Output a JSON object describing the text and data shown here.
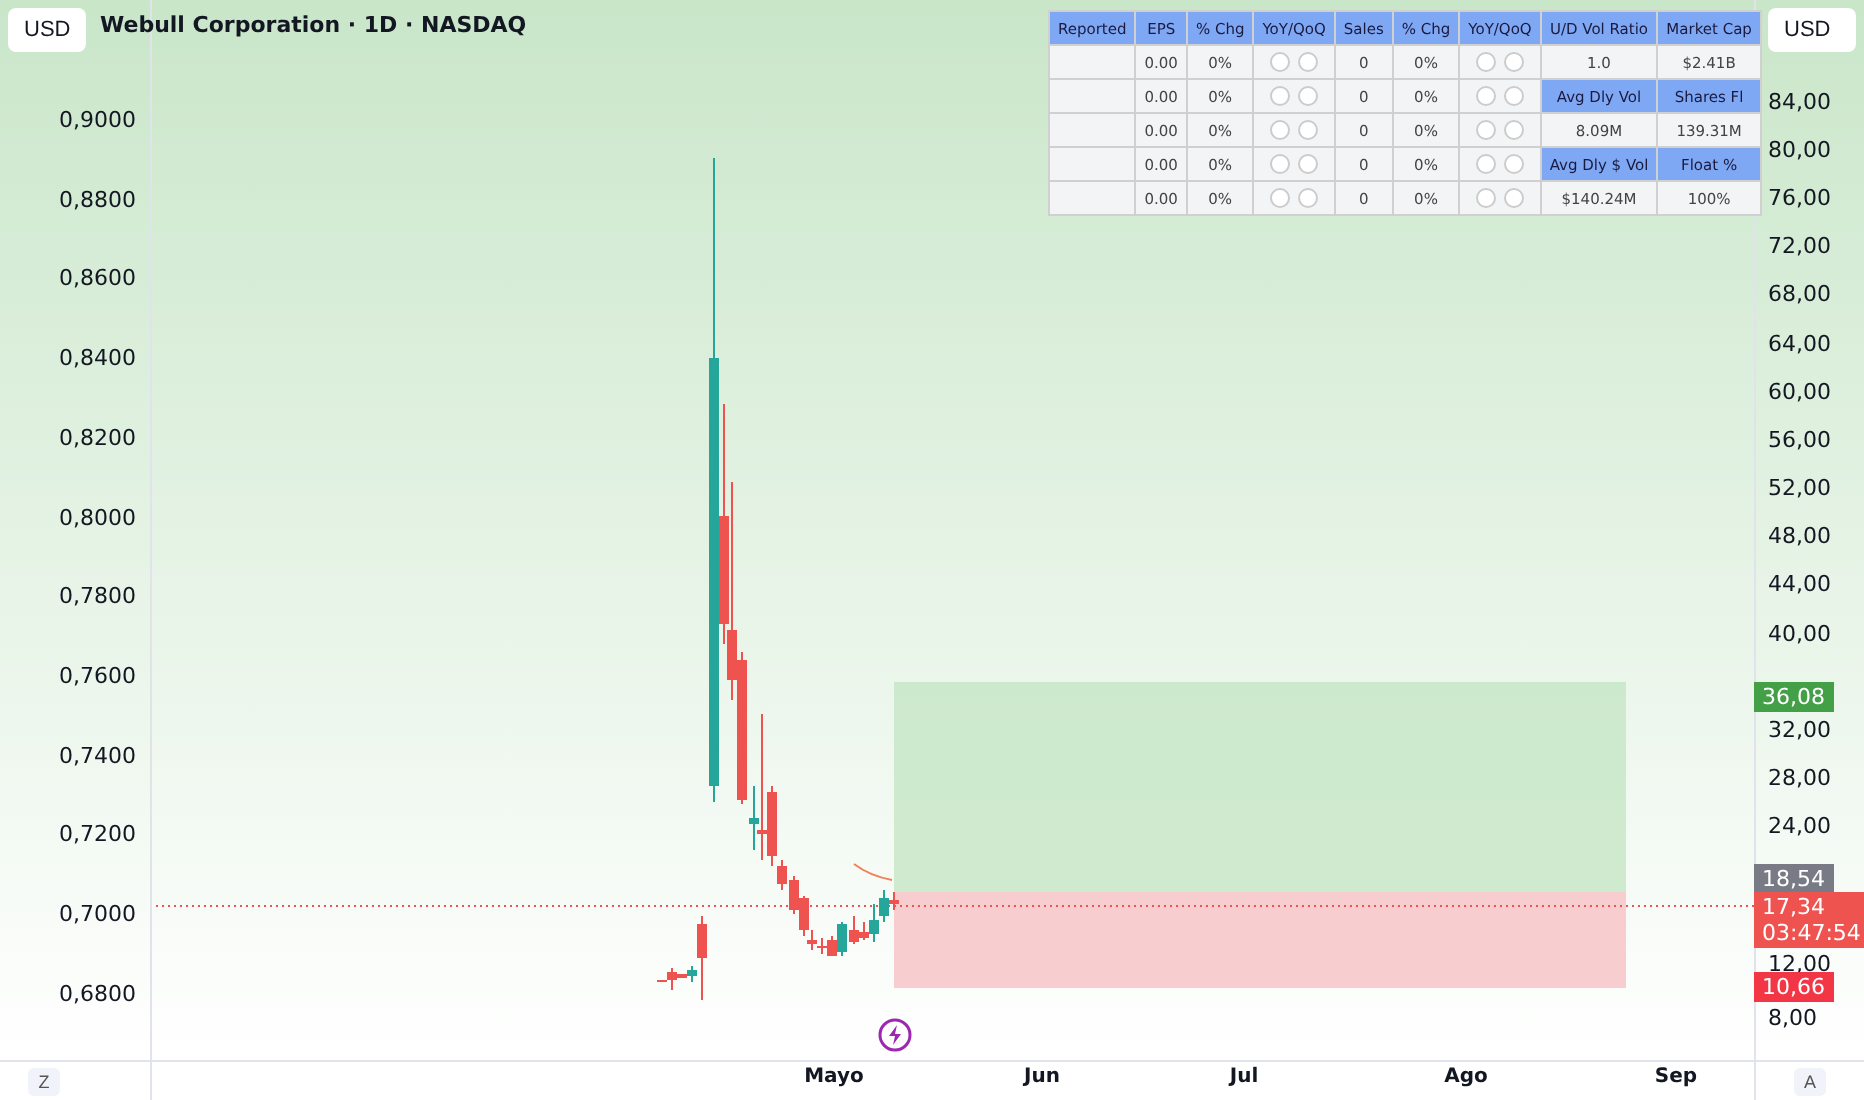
{
  "title": "Webull Corporation · 1D · NASDAQ",
  "currency_left": "USD",
  "currency_right": "USD",
  "left_axis": [
    "0,9000",
    "0,8800",
    "0,8600",
    "0,8400",
    "0,8200",
    "0,8000",
    "0,7800",
    "0,7600",
    "0,7400",
    "0,7200",
    "0,7000",
    "0,6800"
  ],
  "right_axis": [
    "84,00",
    "80,00",
    "76,00",
    "72,00",
    "68,00",
    "64,00",
    "60,00",
    "56,00",
    "52,00",
    "48,00",
    "44,00",
    "40,00",
    "32,00",
    "28,00",
    "24,00",
    "12,00",
    "8,00"
  ],
  "price_labels": [
    {
      "kind": "target",
      "text": "36,08",
      "color": "#43a047"
    },
    {
      "kind": "entry",
      "text": "18,54",
      "color": "#787b86"
    },
    {
      "kind": "last",
      "text": "17,34",
      "countdown": "03:47:54",
      "color": "#ef5350"
    },
    {
      "kind": "stop",
      "text": "10,66",
      "color": "#f23645"
    }
  ],
  "table": {
    "columns": [
      "Reported",
      "EPS",
      "% Chg",
      "YoY/QoQ",
      "Sales",
      "% Chg",
      "YoY/QoQ",
      "U/D Vol Ratio",
      "Market Cap"
    ],
    "rows": [
      {
        "eps": "0.00",
        "eps_chg": "0%",
        "sales": "0",
        "sales_chg": "0%",
        "side": [
          {
            "kind": "value",
            "text": "1.0"
          },
          {
            "kind": "value",
            "text": "$2.41B"
          }
        ]
      },
      {
        "eps": "0.00",
        "eps_chg": "0%",
        "sales": "0",
        "sales_chg": "0%",
        "side": [
          {
            "kind": "header",
            "text": "Avg Dly Vol"
          },
          {
            "kind": "header",
            "text": "Shares Fl"
          }
        ]
      },
      {
        "eps": "0.00",
        "eps_chg": "0%",
        "sales": "0",
        "sales_chg": "0%",
        "side": [
          {
            "kind": "value",
            "text": "8.09M"
          },
          {
            "kind": "value",
            "text": "139.31M"
          }
        ]
      },
      {
        "eps": "0.00",
        "eps_chg": "0%",
        "sales": "0",
        "sales_chg": "0%",
        "side": [
          {
            "kind": "header",
            "text": "Avg Dly $ Vol"
          },
          {
            "kind": "header",
            "text": "Float %"
          }
        ]
      },
      {
        "eps": "0.00",
        "eps_chg": "0%",
        "sales": "0",
        "sales_chg": "0%",
        "side": [
          {
            "kind": "value",
            "text": "$140.24M"
          },
          {
            "kind": "value",
            "text": "100%"
          }
        ]
      }
    ]
  },
  "time_axis": [
    "Mayo",
    "Jun",
    "Jul",
    "Ago",
    "Sep"
  ],
  "corner_left": "Z",
  "corner_right": "A"
}
